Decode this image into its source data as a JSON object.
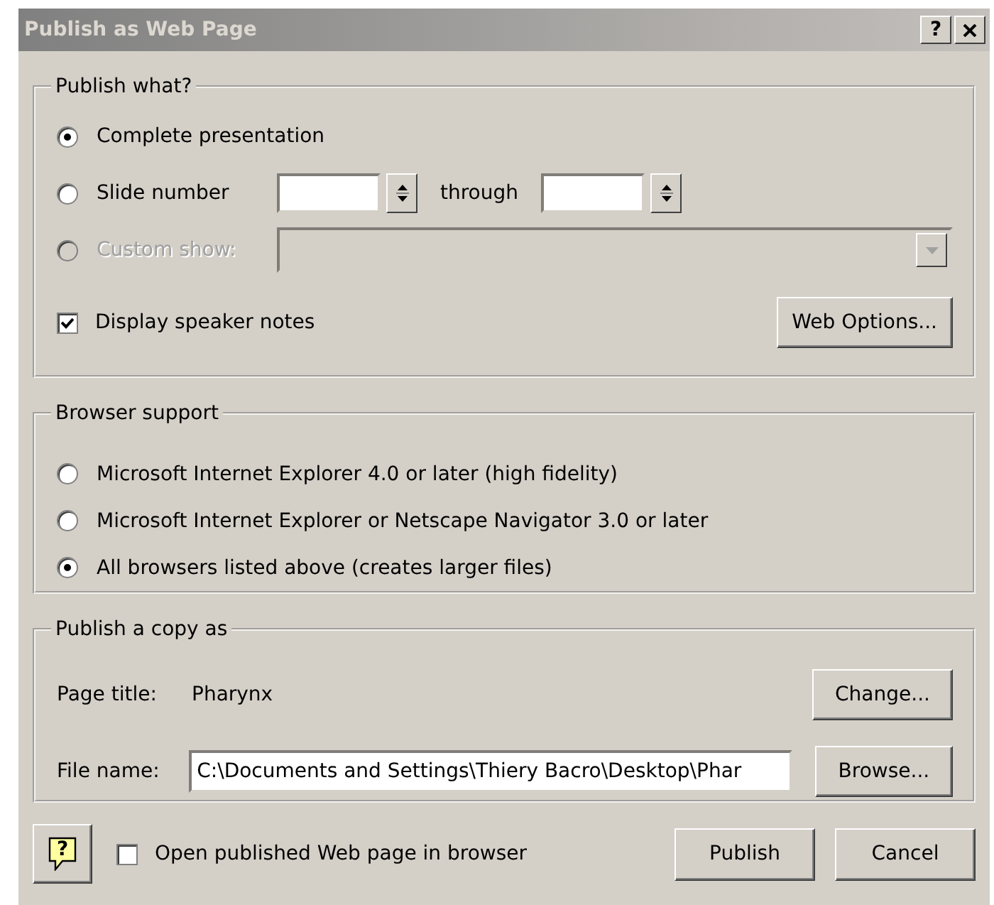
{
  "window": {
    "title": "Publish as Web Page",
    "title_buttons": [
      "?"
    ]
  },
  "publish_what": {
    "label": "Publish what?",
    "options": [
      {
        "kind": "plain",
        "label": "Complete presentation",
        "selected": true,
        "disabled": false
      },
      {
        "kind": "range",
        "label": "Slide number",
        "through_label": "through",
        "selected": false,
        "disabled": false
      },
      {
        "kind": "combo",
        "label": "Custom show:",
        "selected": false,
        "disabled": true
      }
    ],
    "speaker_notes": {
      "label": "Display speaker notes",
      "checked": true
    },
    "options_button": "Web Options..."
  },
  "browser_support": {
    "label": "Browser support",
    "options": [
      {
        "label": "Microsoft Internet Explorer 4.0 or later (high fidelity)",
        "selected": false
      },
      {
        "label": "Microsoft Internet Explorer or Netscape Navigator 3.0 or later",
        "selected": false
      },
      {
        "label": "All browsers listed above (creates larger files)",
        "selected": true
      }
    ]
  },
  "publish_copy": {
    "label": "Publish a copy as",
    "page_title": {
      "label": "Page title:",
      "value": "Pharynx",
      "button": "Change..."
    },
    "file_name": {
      "label": "File name:",
      "value": "C:\\Documents and Settings\\Thiery Bacro\\Desktop\\Phar",
      "button": "Browse..."
    }
  },
  "footer": {
    "help_glyph": "?",
    "open_in_browser": {
      "label": "Open published Web page in browser",
      "checked": false
    },
    "buttons": [
      "Publish",
      "Cancel"
    ]
  }
}
